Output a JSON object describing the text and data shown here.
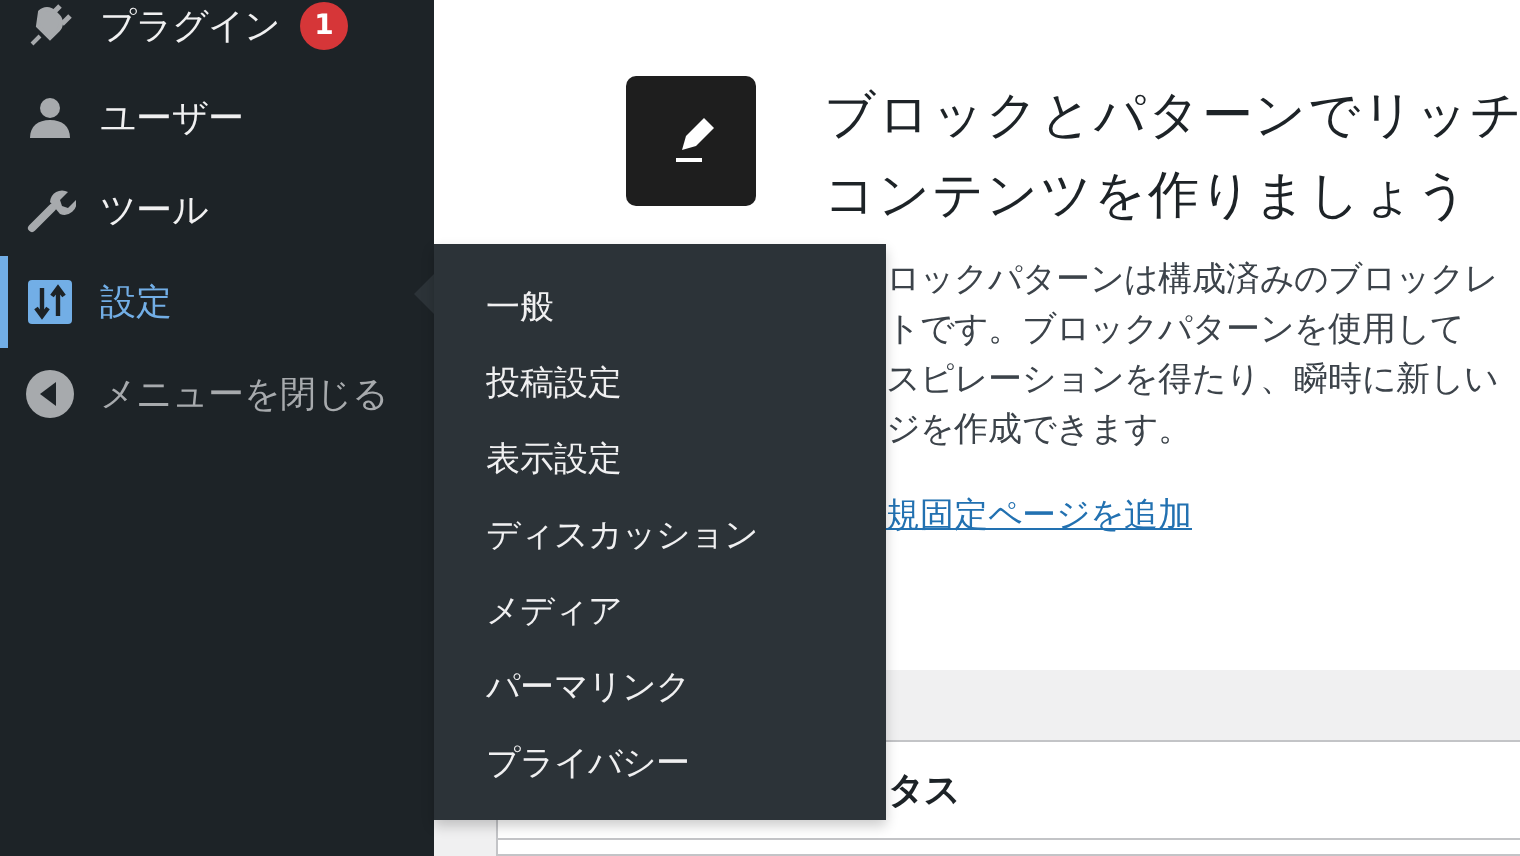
{
  "sidebar": {
    "items": [
      {
        "kind": "menu",
        "label": "プラグイン",
        "badge": "1",
        "selected": false
      },
      {
        "kind": "menu",
        "label": "ユーザー",
        "selected": false
      },
      {
        "kind": "menu",
        "label": "ツール",
        "selected": false
      },
      {
        "kind": "menu",
        "label": "設定",
        "selected": true
      },
      {
        "kind": "collapse",
        "label": "メニューを閉じる",
        "selected": false
      }
    ]
  },
  "flyout": {
    "items": [
      "一般",
      "投稿設定",
      "表示設定",
      "ディスカッション",
      "メディア",
      "パーマリンク",
      "プライバシー"
    ]
  },
  "welcome": {
    "heading": [
      "ブロックとパターンでリッチ",
      "コンテンツを作りましょう"
    ],
    "paragraph": [
      "ロックパターンは構成済みのブロックレ",
      "トです。ブロックパターンを使用して",
      "スピレーションを得たり、瞬時に新しい",
      "ジを作成できます。"
    ],
    "link": "規固定ページを追加"
  },
  "status_card": {
    "title": "タス"
  }
}
